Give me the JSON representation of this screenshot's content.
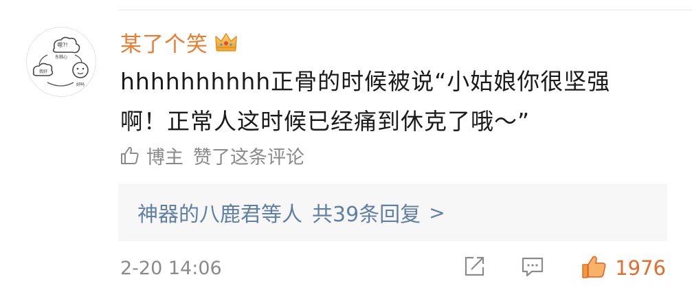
{
  "user": {
    "name": "某了个笑",
    "avatar_text": [
      "嗯?!",
      "东桃心",
      "我好",
      "好吗"
    ],
    "badge_icon": "crown-icon"
  },
  "comment": {
    "lines": [
      "hhhhhhhhhh正骨的时候被说“小姑娘你很坚强",
      "啊！正常人这时候已经痛到休克了哦～”"
    ]
  },
  "author_liked": {
    "icon": "thumbs-up-outline-icon",
    "author_label": "博主",
    "text": "赞了这条评论"
  },
  "replies": {
    "names": "神器的八鹿君等人",
    "count_text": "共39条回复",
    "chevron": ">"
  },
  "footer": {
    "timestamp": "2-20 14:06",
    "like_count": "1976"
  },
  "colors": {
    "username": "#ea7c31",
    "link": "#5f7fa5",
    "like": "#e36d2b",
    "muted": "#8a8a8a",
    "reply_bg": "#f7f7f7"
  }
}
